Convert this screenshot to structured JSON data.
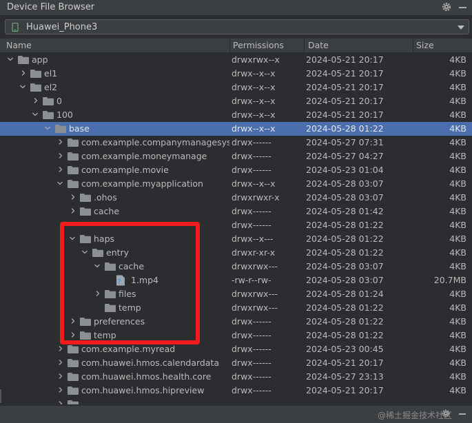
{
  "window": {
    "title": "Device File Browser"
  },
  "device": {
    "name": "Huawei_Phone3"
  },
  "columns": {
    "name": "Name",
    "permissions": "Permissions",
    "date": "Date",
    "size": "Size"
  },
  "rows": [
    {
      "name": "app",
      "depth": 1,
      "expanded": true,
      "kind": "folder",
      "perm": "drwxrwx--x",
      "date": "2024-05-21 20:17",
      "size": "4KB"
    },
    {
      "name": "el1",
      "depth": 2,
      "expanded": false,
      "kind": "folder",
      "perm": "drwx--x--x",
      "date": "2024-05-21 20:17",
      "size": "4KB"
    },
    {
      "name": "el2",
      "depth": 2,
      "expanded": true,
      "kind": "folder",
      "perm": "drwx--x--x",
      "date": "2024-05-21 20:17",
      "size": "4KB"
    },
    {
      "name": "0",
      "depth": 3,
      "expanded": false,
      "kind": "folder",
      "perm": "drwx--x--x",
      "date": "2024-05-21 20:17",
      "size": "4KB"
    },
    {
      "name": "100",
      "depth": 3,
      "expanded": true,
      "kind": "folder",
      "perm": "drwx--x--x",
      "date": "2024-05-21 20:17",
      "size": "4KB"
    },
    {
      "name": "base",
      "depth": 4,
      "expanded": true,
      "kind": "folder",
      "perm": "drwx--x--x",
      "date": "2024-05-28 01:22",
      "size": "4KB",
      "selected": true
    },
    {
      "name": "com.example.companymanagesystem",
      "depth": 5,
      "expanded": false,
      "kind": "folder",
      "perm": "drwx------",
      "date": "2024-05-27 07:31",
      "size": "4KB"
    },
    {
      "name": "com.example.moneymanage",
      "depth": 5,
      "expanded": false,
      "kind": "folder",
      "perm": "drwx------",
      "date": "2024-05-27 04:27",
      "size": "4KB"
    },
    {
      "name": "com.example.movie",
      "depth": 5,
      "expanded": false,
      "kind": "folder",
      "perm": "drwx------",
      "date": "2024-05-23 01:04",
      "size": "4KB"
    },
    {
      "name": "com.example.myapplication",
      "depth": 5,
      "expanded": true,
      "kind": "folder",
      "perm": "drwx--x--x",
      "date": "2024-05-28 03:07",
      "size": "4KB"
    },
    {
      "name": ".ohos",
      "depth": 6,
      "expanded": false,
      "kind": "folder",
      "perm": "drwxrwxr-x",
      "date": "2024-05-28 03:07",
      "size": "4KB"
    },
    {
      "name": "cache",
      "depth": 6,
      "expanded": false,
      "kind": "folder",
      "perm": "drwx------",
      "date": "2024-05-28 01:42",
      "size": "4KB"
    },
    {
      "name": "",
      "depth": 6,
      "expanded": false,
      "kind": "none",
      "perm": "drwx------",
      "date": "2024-05-28 01:22",
      "size": "4KB"
    },
    {
      "name": "haps",
      "depth": 6,
      "expanded": true,
      "kind": "folder",
      "perm": "drwx--x---",
      "date": "2024-05-28 01:22",
      "size": "4KB"
    },
    {
      "name": "entry",
      "depth": 7,
      "expanded": true,
      "kind": "folder",
      "perm": "drwxr-xr-x",
      "date": "2024-05-28 01:22",
      "size": "4KB"
    },
    {
      "name": "cache",
      "depth": 8,
      "expanded": true,
      "kind": "folder",
      "perm": "drwxrwx---",
      "date": "2024-05-28 03:07",
      "size": "4KB"
    },
    {
      "name": "1.mp4",
      "depth": 9,
      "expanded": false,
      "kind": "file",
      "perm": "-rw-r--rw-",
      "date": "2024-05-28 03:07",
      "size": "20.7MB"
    },
    {
      "name": "files",
      "depth": 8,
      "expanded": false,
      "kind": "folder",
      "perm": "drwxrwx---",
      "date": "2024-05-28 01:24",
      "size": "4KB"
    },
    {
      "name": "temp",
      "depth": 8,
      "expanded": false,
      "kind": "folder-noarrow",
      "perm": "drwxrwx---",
      "date": "2024-05-28 01:22",
      "size": "4KB"
    },
    {
      "name": "preferences",
      "depth": 6,
      "expanded": false,
      "kind": "folder",
      "perm": "drwx------",
      "date": "2024-05-28 01:22",
      "size": "4KB"
    },
    {
      "name": "temp",
      "depth": 6,
      "expanded": false,
      "kind": "folder",
      "perm": "drwx------",
      "date": "2024-05-28 01:22",
      "size": "4KB"
    },
    {
      "name": "com.example.myread",
      "depth": 5,
      "expanded": false,
      "kind": "folder",
      "perm": "drwx------",
      "date": "2024-05-23 00:45",
      "size": "4KB"
    },
    {
      "name": "com.huawei.hmos.calendardata",
      "depth": 5,
      "expanded": false,
      "kind": "folder",
      "perm": "drwx------",
      "date": "2024-05-21 20:17",
      "size": "4KB"
    },
    {
      "name": "com.huawei.hmos.health.core",
      "depth": 5,
      "expanded": false,
      "kind": "folder",
      "perm": "drwx------",
      "date": "2024-05-27 23:13",
      "size": "4KB"
    },
    {
      "name": "com.huawei.hmos.hipreview",
      "depth": 5,
      "expanded": false,
      "kind": "folder",
      "perm": "drwx------",
      "date": "2024-05-21 20:17",
      "size": "4KB"
    },
    {
      "name": "",
      "depth": 5,
      "expanded": false,
      "kind": "folder",
      "perm": "",
      "date": "",
      "size": ""
    }
  ],
  "footer": {
    "watermark": "@稀土掘金技术社区"
  },
  "colors": {
    "selection": "#4b6eaf",
    "highlight": "#f21c1c",
    "folder": "#8c8f93"
  },
  "icons": [
    "gear-icon",
    "minimize-icon",
    "phone-icon",
    "chevron-down-icon",
    "folder-icon",
    "video-file-icon",
    "expand-arrow-icon",
    "collapse-arrow-icon"
  ]
}
